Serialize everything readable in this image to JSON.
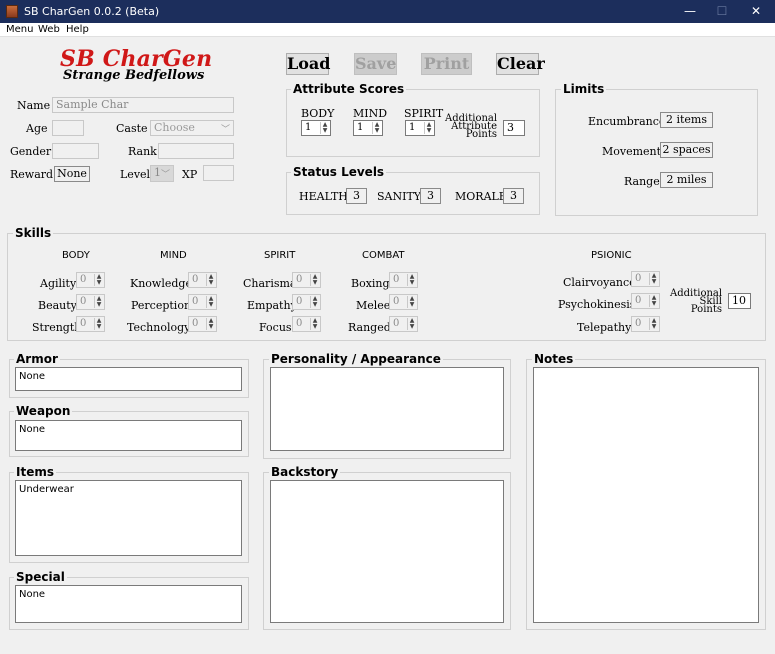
{
  "window": {
    "title": "SB CharGen 0.0.2 (Beta)",
    "min": "—",
    "max": "☐",
    "close": "✕"
  },
  "menu": [
    "Menu",
    "Web",
    "Help"
  ],
  "brand": {
    "title": "SB CharGen",
    "subtitle": "Strange Bedfellows"
  },
  "toolbar": {
    "load": "Load",
    "save": "Save",
    "print": "Print",
    "clear": "Clear"
  },
  "character": {
    "name_label": "Name",
    "name_value": "Sample Char",
    "age_label": "Age",
    "age_value": "",
    "caste_label": "Caste",
    "caste_value": "Choose",
    "gender_label": "Gender",
    "gender_value": "",
    "rank_label": "Rank",
    "rank_value": "",
    "reward_label": "Reward",
    "reward_value": "None",
    "level_label": "Level",
    "level_value": "1",
    "xp_label": "XP",
    "xp_value": ""
  },
  "attributes": {
    "title": "Attribute Scores",
    "body_label": "BODY",
    "body_value": "1",
    "mind_label": "MIND",
    "mind_value": "1",
    "spirit_label": "SPIRIT",
    "spirit_value": "1",
    "additional_line1": "Additional",
    "additional_line2": "Attribute",
    "additional_line3": "Points",
    "additional_value": "3"
  },
  "status": {
    "title": "Status Levels",
    "health_label": "HEALTH",
    "health_value": "3",
    "sanity_label": "SANITY",
    "sanity_value": "3",
    "morale_label": "MORALE",
    "morale_value": "3"
  },
  "limits": {
    "title": "Limits",
    "encumbrance_label": "Encumbrance",
    "encumbrance_value": "2 items",
    "movement_label": "Movement",
    "movement_value": "2 spaces",
    "range_label": "Range",
    "range_value": "2 miles"
  },
  "skills": {
    "title": "Skills",
    "body_head": "BODY",
    "mind_head": "MIND",
    "spirit_head": "SPIRIT",
    "combat_head": "COMBAT",
    "psionic_head": "PSIONIC",
    "agility": "Agility",
    "beauty": "Beauty",
    "strength": "Strength",
    "knowledge": "Knowledge",
    "perception": "Perception",
    "technology": "Technology",
    "charisma": "Charisma",
    "empathy": "Empathy",
    "focus": "Focus",
    "boxing": "Boxing",
    "melee": "Melee",
    "ranged": "Ranged",
    "clairvoyance": "Clairvoyance",
    "psychokinesis": "Psychokinesis",
    "telepathy": "Telepathy",
    "value": "0",
    "additional_line1": "Additional",
    "additional_line2": "Skill",
    "additional_line3": "Points",
    "additional_value": "10"
  },
  "armor": {
    "title": "Armor",
    "value": "None"
  },
  "weapon": {
    "title": "Weapon",
    "value": "None"
  },
  "items": {
    "title": "Items",
    "value": "Underwear"
  },
  "special": {
    "title": "Special",
    "value": "None"
  },
  "personality": {
    "title": "Personality / Appearance",
    "value": ""
  },
  "backstory": {
    "title": "Backstory",
    "value": ""
  },
  "notes": {
    "title": "Notes",
    "value": ""
  },
  "colors": {
    "titlebar": "#1c2e5c",
    "brand": "#d01818"
  }
}
